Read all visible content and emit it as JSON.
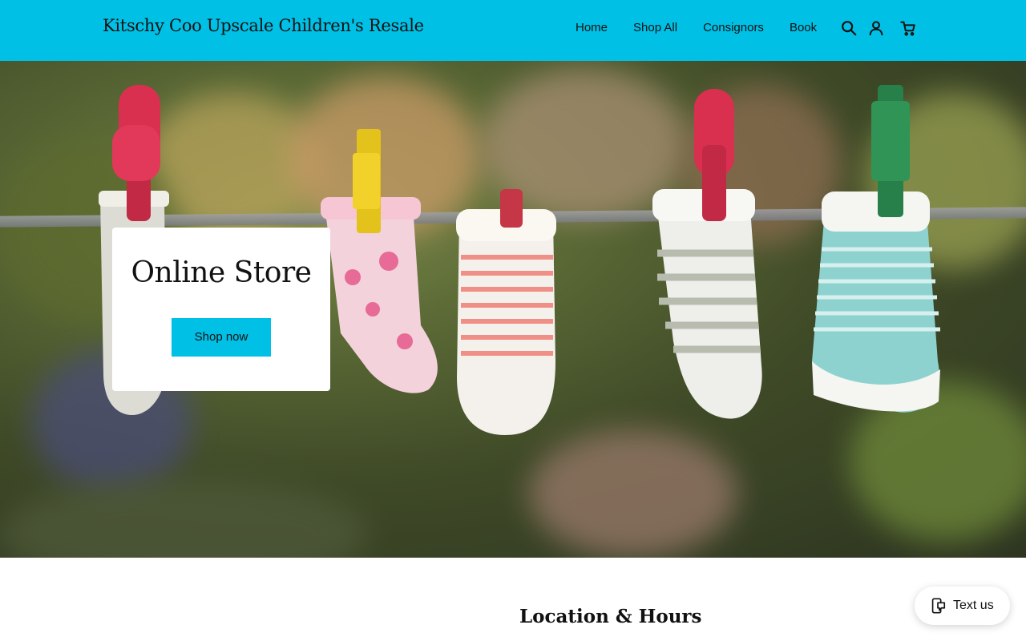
{
  "header": {
    "brand": "Kitschy Coo Upscale Children's Resale",
    "nav": [
      "Home",
      "Shop All",
      "Consignors",
      "Book"
    ],
    "icons": [
      "search-icon",
      "account-icon",
      "cart-icon"
    ],
    "bg_color": "#00c0e6"
  },
  "hero": {
    "image_subject": "baby socks on a clothesline",
    "title": "Online Store",
    "button": "Shop now",
    "button_color": "#00c0e6"
  },
  "section": {
    "title": "Location & Hours"
  },
  "chat": {
    "label": "Text us",
    "icon": "message-icon"
  }
}
